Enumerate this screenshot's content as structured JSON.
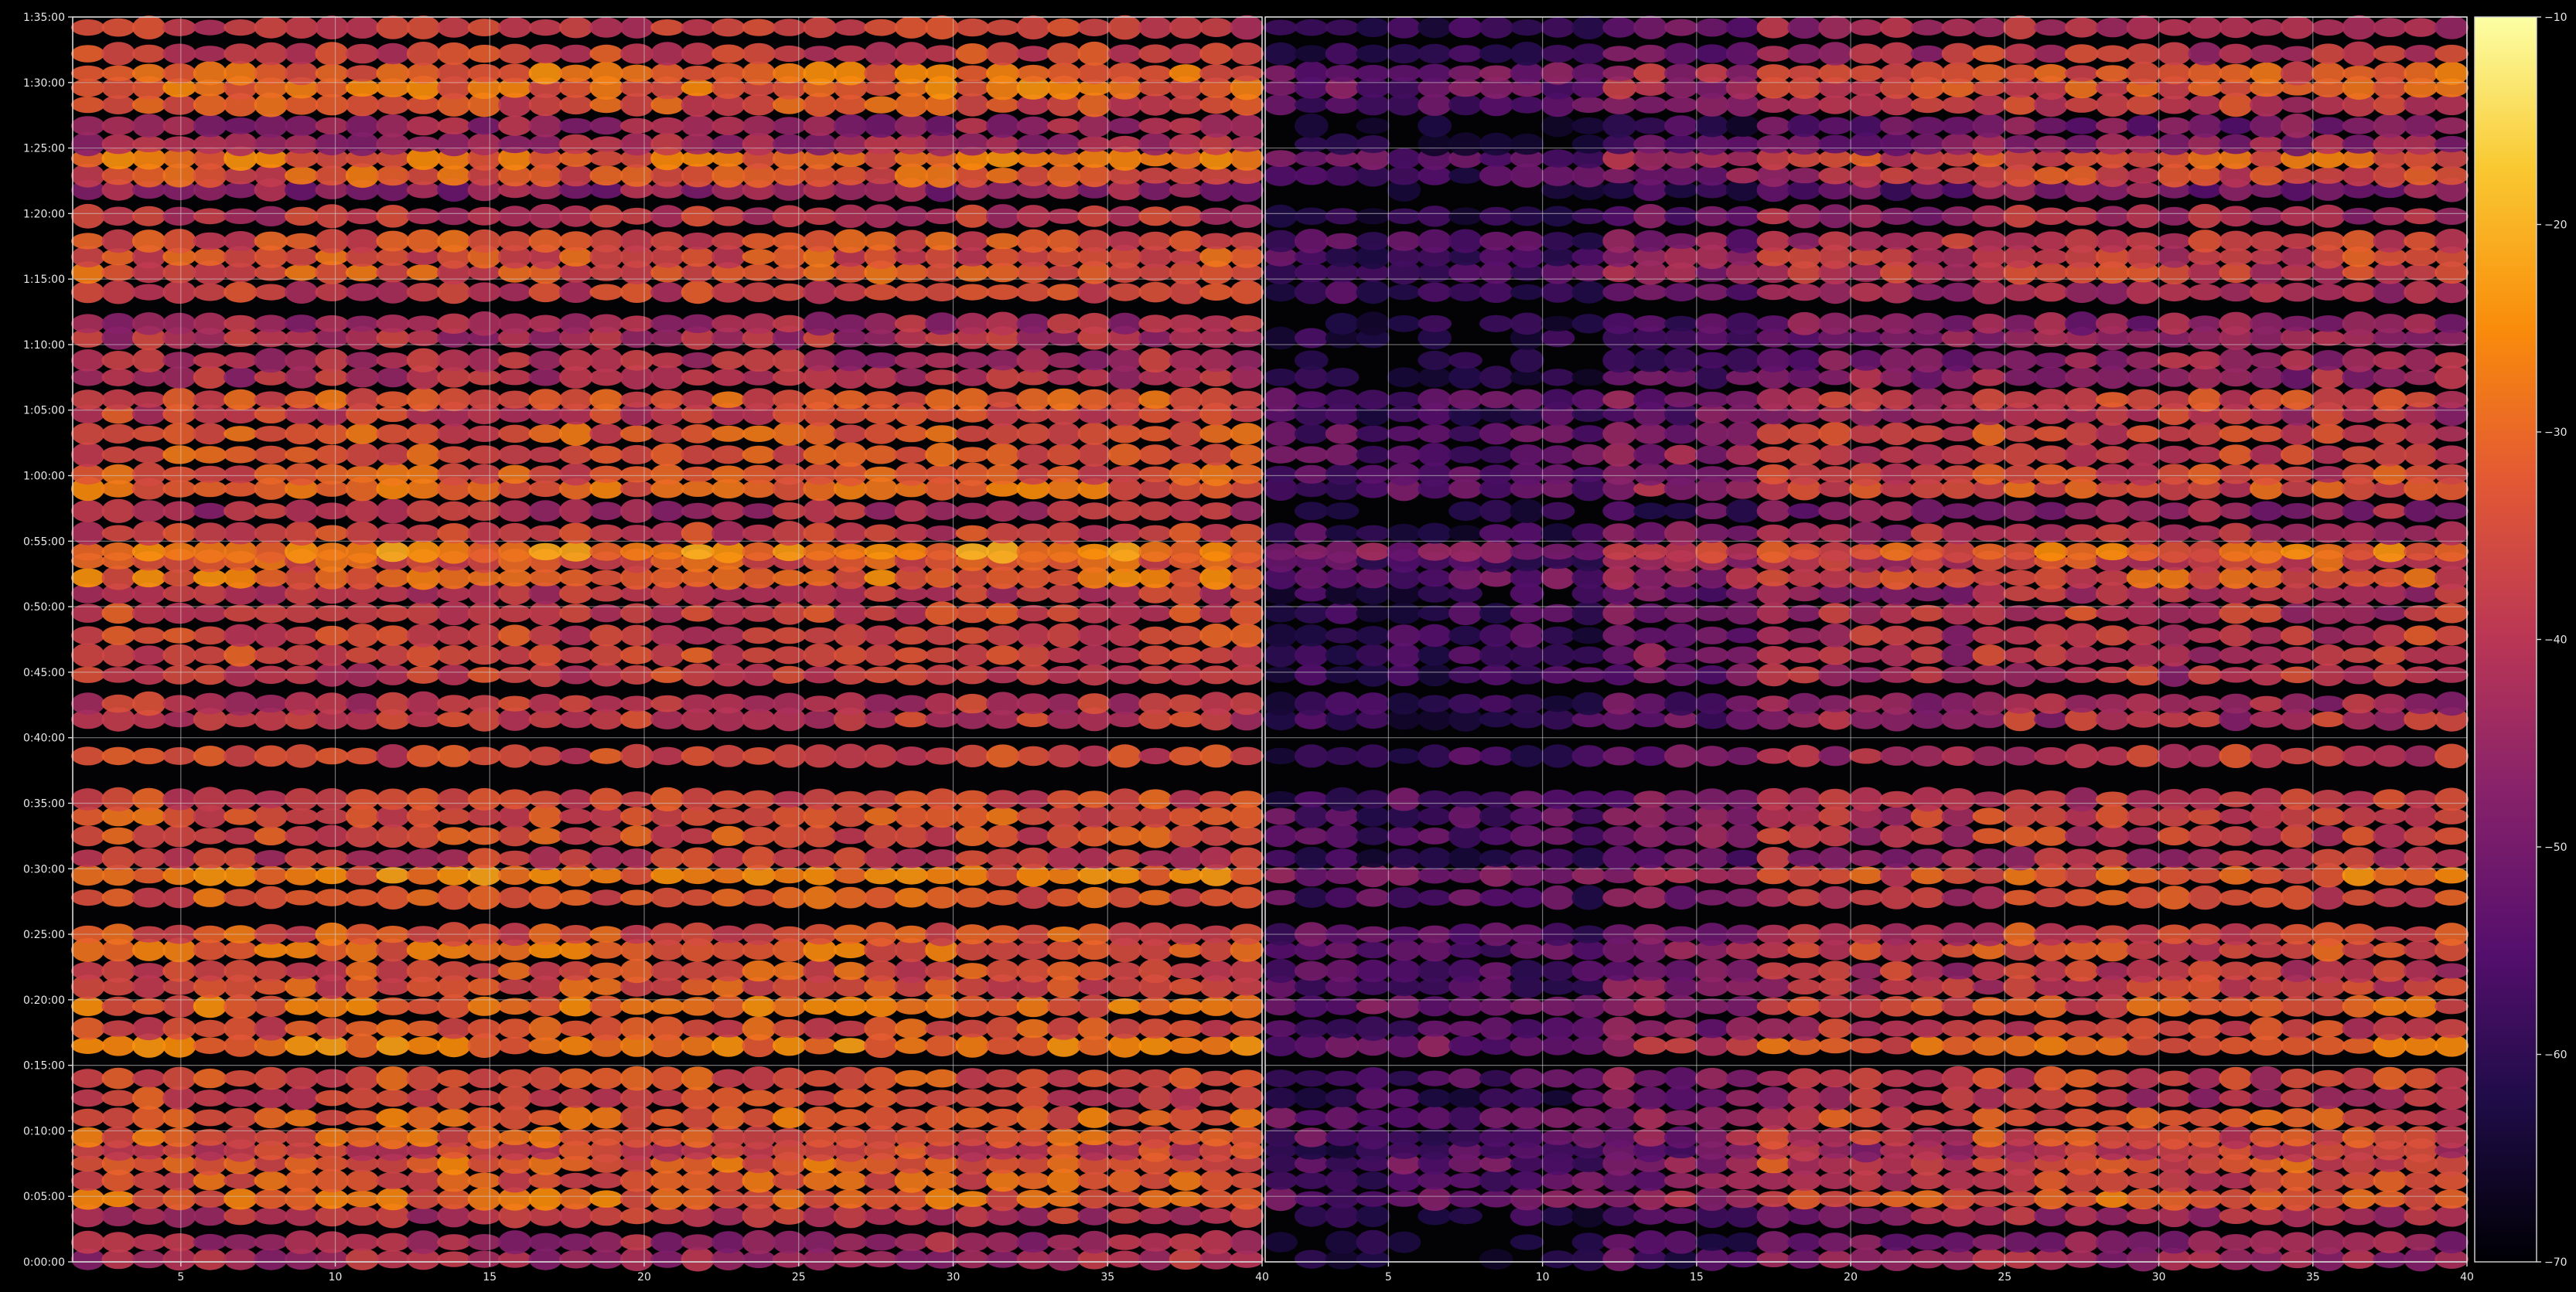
{
  "chart_data": {
    "type": "heatmap",
    "title": "",
    "xlabel": "",
    "ylabel": "",
    "panels": [
      {
        "name": "",
        "x_range": [
          1.5,
          40
        ],
        "x_ticks": [
          5,
          10,
          15,
          20,
          25,
          30,
          35,
          40
        ],
        "x_tick_labels": [
          "5",
          "10",
          "15",
          "20",
          "25",
          "30",
          "35",
          "40"
        ]
      },
      {
        "name": "",
        "x_range": [
          1,
          40
        ],
        "x_ticks": [
          5,
          10,
          15,
          20,
          25,
          30,
          35,
          40
        ],
        "x_tick_labels": [
          "5",
          "10",
          "15",
          "20",
          "25",
          "30",
          "35",
          "40"
        ]
      }
    ],
    "y_range_minutes": [
      0,
      95
    ],
    "y_ticks_minutes": [
      0,
      5,
      10,
      15,
      20,
      25,
      30,
      35,
      40,
      45,
      50,
      55,
      60,
      65,
      70,
      75,
      80,
      85,
      90,
      95
    ],
    "y_tick_labels": [
      "0:00:00",
      "0:05:00",
      "0:10:00",
      "0:15:00",
      "0:20:00",
      "0:25:00",
      "0:30:00",
      "0:35:00",
      "0:40:00",
      "0:45:00",
      "0:50:00",
      "0:55:00",
      "1:00:00",
      "1:05:00",
      "1:10:00",
      "1:15:00",
      "1:20:00",
      "1:25:00",
      "1:30:00",
      "1:35:00"
    ],
    "grid": true,
    "colormap": "inferno",
    "color_range": [
      -70,
      -10
    ],
    "colorbar_ticks": [
      -70,
      -60,
      -50,
      -40,
      -30,
      -20,
      -10
    ],
    "colorbar_tick_labels": [
      "−70",
      "−60",
      "−50",
      "−40",
      "−30",
      "−20",
      "−10"
    ],
    "band_profile_minutes_level": [
      [
        0.2,
        -42
      ],
      [
        1.5,
        -44
      ],
      [
        3.5,
        -40
      ],
      [
        4.8,
        -30
      ],
      [
        6.2,
        -33
      ],
      [
        7.5,
        -31
      ],
      [
        8.5,
        -36
      ],
      [
        9.5,
        -32
      ],
      [
        11,
        -31
      ],
      [
        12.5,
        -36
      ],
      [
        14,
        -34
      ],
      [
        16.5,
        -27
      ],
      [
        17.8,
        -34
      ],
      [
        19.5,
        -30
      ],
      [
        21,
        -34
      ],
      [
        22.2,
        -34
      ],
      [
        23.8,
        -31
      ],
      [
        25,
        -33
      ],
      [
        27.8,
        -33
      ],
      [
        29.5,
        -28
      ],
      [
        30.8,
        -38
      ],
      [
        32.5,
        -34
      ],
      [
        34,
        -33
      ],
      [
        35.3,
        -35
      ],
      [
        38.6,
        -36
      ],
      [
        41.4,
        -38
      ],
      [
        42.6,
        -39
      ],
      [
        44.8,
        -37
      ],
      [
        46.3,
        -36
      ],
      [
        47.8,
        -36
      ],
      [
        49.5,
        -36
      ],
      [
        51,
        -39
      ],
      [
        52.2,
        -30
      ],
      [
        53.5,
        -33
      ],
      [
        54.2,
        -26
      ],
      [
        55.6,
        -37
      ],
      [
        57.3,
        -42
      ],
      [
        59,
        -31
      ],
      [
        60.1,
        -33
      ],
      [
        61.6,
        -33
      ],
      [
        63.2,
        -33
      ],
      [
        64.7,
        -37
      ],
      [
        65.8,
        -33
      ],
      [
        67.5,
        -41
      ],
      [
        68.8,
        -42
      ],
      [
        70.5,
        -41
      ],
      [
        71.6,
        -43
      ],
      [
        74,
        -37
      ],
      [
        75.5,
        -33
      ],
      [
        76.7,
        -34
      ],
      [
        77.9,
        -34
      ],
      [
        79.8,
        -39
      ],
      [
        81.8,
        -46
      ],
      [
        82.9,
        -33
      ],
      [
        84.2,
        -30
      ],
      [
        85.3,
        -43
      ],
      [
        86.7,
        -45
      ],
      [
        88.3,
        -34
      ],
      [
        89.6,
        -30
      ],
      [
        90.7,
        -30
      ],
      [
        92.2,
        -36
      ],
      [
        94.2,
        -38
      ]
    ]
  }
}
